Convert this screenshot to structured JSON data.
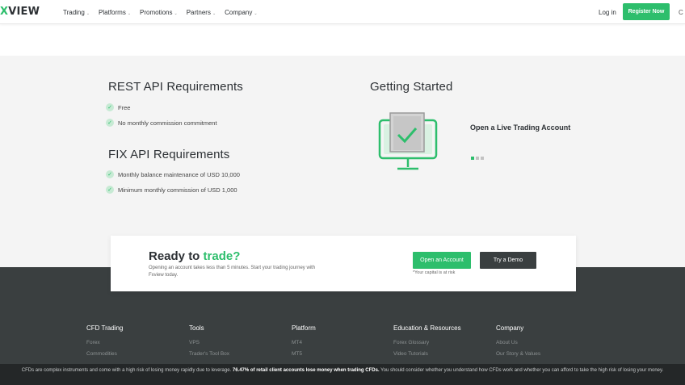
{
  "header": {
    "logo": {
      "prefix": "X",
      "suffix": "VIEW"
    },
    "nav": [
      {
        "label": "Trading"
      },
      {
        "label": "Platforms"
      },
      {
        "label": "Promotions"
      },
      {
        "label": "Partners"
      },
      {
        "label": "Company"
      }
    ],
    "login_label": "Log in",
    "register_label": "Register Now",
    "lang_label": "C"
  },
  "rest_api": {
    "title": "REST API Requirements",
    "items": [
      "Free",
      "No monthly commission commitment"
    ]
  },
  "fix_api": {
    "title": "FIX API Requirements",
    "items": [
      "Monthly balance maintenance of USD 10,000",
      "Minimum monthly commission of USD 1,000"
    ]
  },
  "getting_started": {
    "title": "Getting Started",
    "slide_label": "Open a Live Trading Account",
    "slides_count": 3,
    "active_slide": 0,
    "icon": "monitor-check-icon"
  },
  "cta": {
    "title_prefix": "Ready to ",
    "title_highlight": "trade?",
    "description": "Opening an account takes less than 5 minutes. Start your trading journey with Fxview today.",
    "open_account_label": "Open an Account",
    "try_demo_label": "Try a Demo",
    "risk_note": "*Your capital is at risk"
  },
  "footer": {
    "columns": [
      {
        "title": "CFD Trading",
        "links": [
          "Forex",
          "Commodities"
        ]
      },
      {
        "title": "Tools",
        "links": [
          "VPS",
          "Trader's Tool Box"
        ]
      },
      {
        "title": "Platform",
        "links": [
          "MT4",
          "MT5"
        ]
      },
      {
        "title": "Education & Resources",
        "links": [
          "Forex Glossary",
          "Video Tutorials"
        ]
      },
      {
        "title": "Company",
        "links": [
          "About Us",
          "Our Story & Values"
        ]
      }
    ]
  },
  "risk_warning": {
    "part1": "CFDs are complex instruments and come with a high risk of losing money rapidly due to leverage. ",
    "bold": "76.47% of retail client accounts lose money when trading CFDs.",
    "part2": " You should consider whether you understand how CFDs work and whether you can afford to take the high risk of losing your money."
  },
  "colors": {
    "brand_green": "#2dbe6c",
    "dark": "#3a3f40",
    "section_bg": "#f4f4f4"
  }
}
